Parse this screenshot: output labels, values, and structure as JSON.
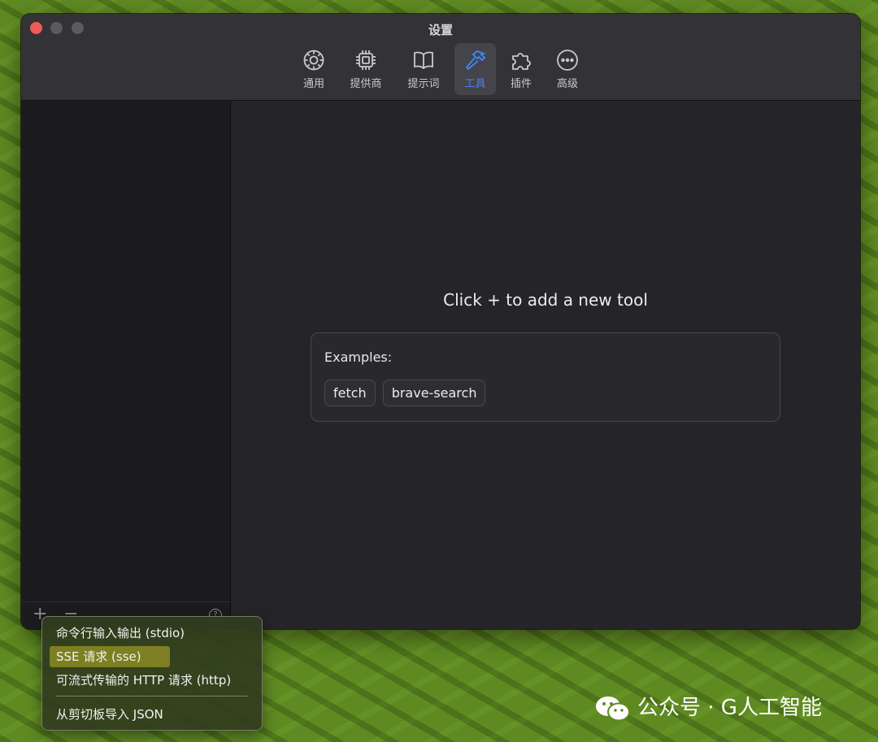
{
  "window": {
    "title": "设置"
  },
  "toolbar": {
    "items": [
      {
        "label": "通用",
        "icon": "gear-icon",
        "active": false
      },
      {
        "label": "提供商",
        "icon": "chip-icon",
        "active": false
      },
      {
        "label": "提示词",
        "icon": "book-icon",
        "active": false
      },
      {
        "label": "工具",
        "icon": "hammer-icon",
        "active": true
      },
      {
        "label": "插件",
        "icon": "puzzle-icon",
        "active": false
      },
      {
        "label": "高级",
        "icon": "ellipsis-circle-icon",
        "active": false
      }
    ]
  },
  "sidebar": {
    "add_label": "+",
    "remove_label": "−",
    "help_label": "?"
  },
  "main": {
    "hint": "Click + to add a new tool",
    "examples_title": "Examples:",
    "examples": [
      "fetch",
      "brave-search"
    ]
  },
  "menu": {
    "items": [
      {
        "label": "命令行输入输出 (stdio)",
        "highlighted": false
      },
      {
        "label": "SSE 请求 (sse)",
        "highlighted": true
      },
      {
        "label": "可流式传输的 HTTP 请求 (http)",
        "highlighted": false
      },
      {
        "label": "从剪切板导入 JSON",
        "highlighted": false
      }
    ]
  },
  "watermark": {
    "text": "公众号 · G人工智能",
    "icon": "wechat-icon"
  },
  "colors": {
    "accent": "#3d86f5",
    "window_bg": "#252429",
    "menu_highlight": "#7d7f22",
    "desktop": "#5f8a22"
  }
}
